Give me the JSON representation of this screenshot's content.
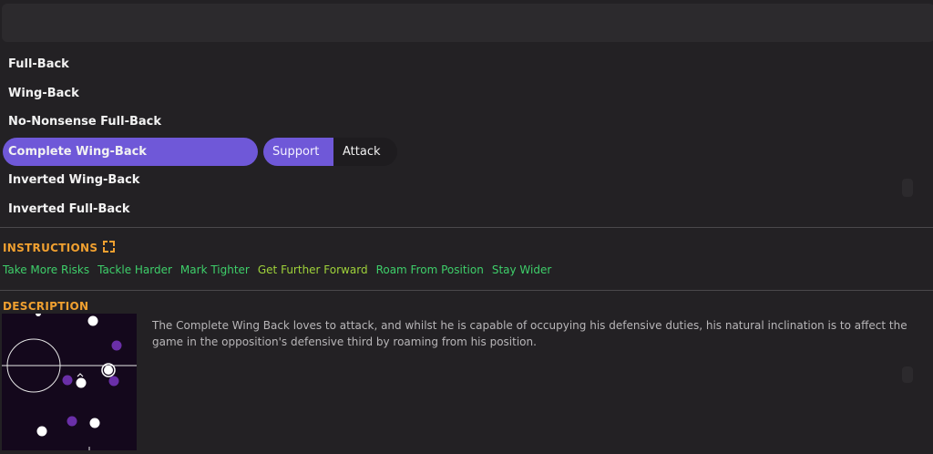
{
  "top_bar": {},
  "roles": [
    {
      "label": "Full-Back",
      "selected": false
    },
    {
      "label": "Wing-Back",
      "selected": false
    },
    {
      "label": "No-Nonsense Full-Back",
      "selected": false
    },
    {
      "label": "Complete Wing-Back",
      "selected": true
    },
    {
      "label": "Inverted Wing-Back",
      "selected": false
    },
    {
      "label": "Inverted Full-Back",
      "selected": false
    }
  ],
  "duties": {
    "support_label": "Support",
    "attack_label": "Attack",
    "selected": "Support"
  },
  "instructions": {
    "title": "INSTRUCTIONS",
    "items": [
      {
        "label": "Take More Risks",
        "color": "#3ecf6a"
      },
      {
        "label": "Tackle Harder",
        "color": "#3ecf6a"
      },
      {
        "label": "Mark Tighter",
        "color": "#3ecf6a"
      },
      {
        "label": "Get Further Forward",
        "color": "#9fd23a"
      },
      {
        "label": "Roam From Position",
        "color": "#3ecf6a"
      },
      {
        "label": "Stay Wider",
        "color": "#3ecf6a"
      }
    ]
  },
  "description": {
    "title": "DESCRIPTION",
    "text": "The Complete Wing Back loves to attack, and whilst he is capable of occupying his defensive duties, his natural inclination is to affect the game in the opposition's defensive third by roaming from his position."
  },
  "colors": {
    "accent": "#6f58d8",
    "section_title": "#f0a030",
    "pitch_bg": "#14081c",
    "team_dot": "#ffffff",
    "opponent_dot": "#6a2fa8"
  },
  "icons": {
    "expand": "expand-icon"
  }
}
